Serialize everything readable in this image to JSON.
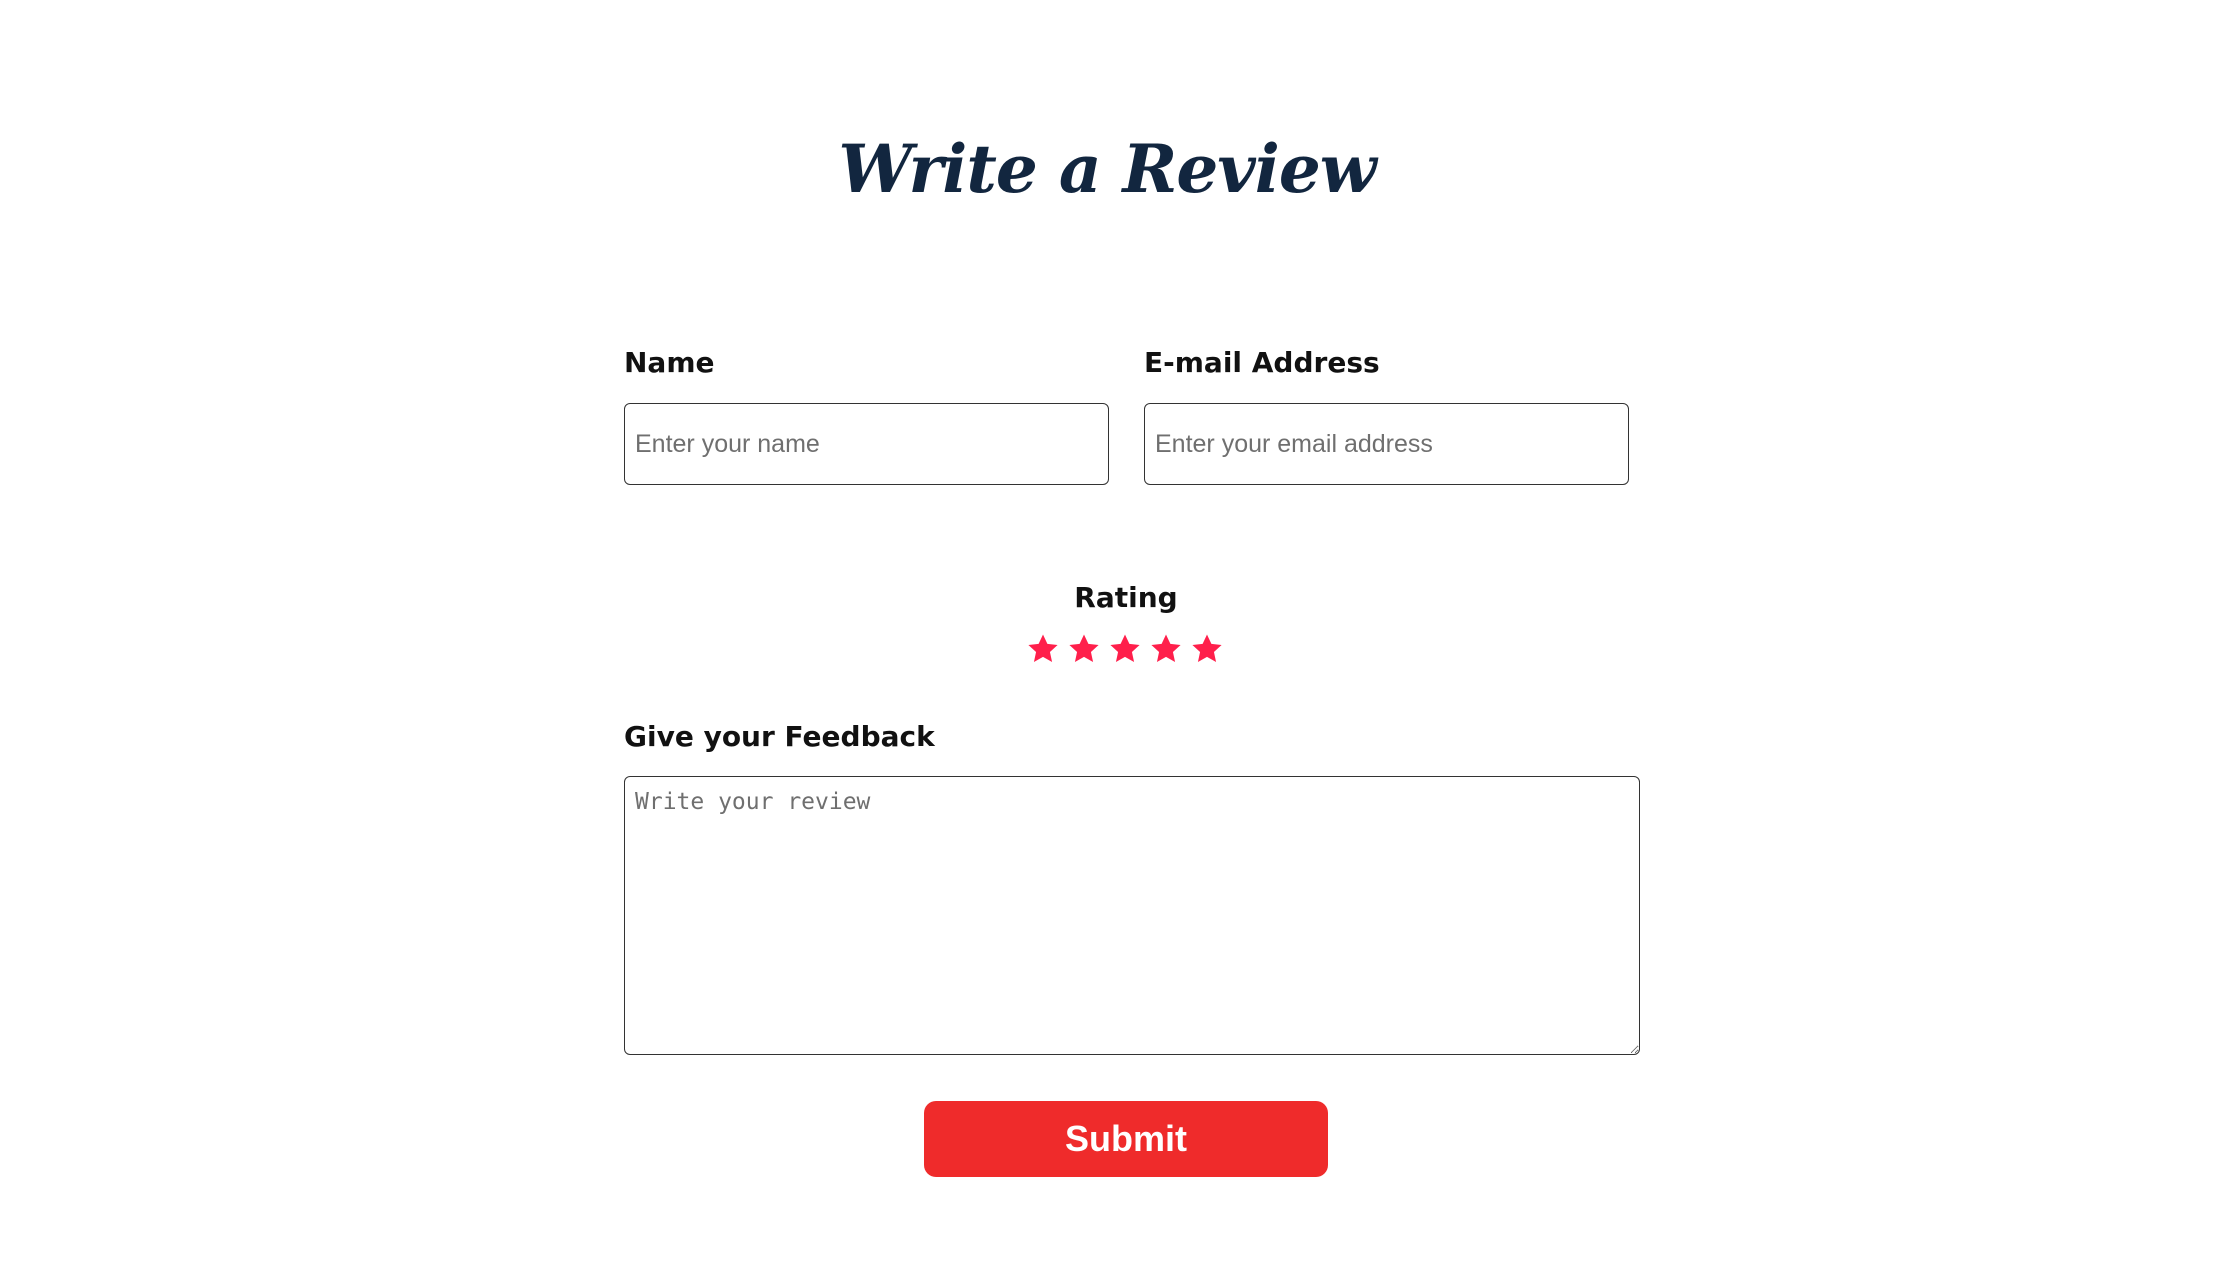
{
  "page": {
    "title": "Write a Review"
  },
  "form": {
    "name": {
      "label": "Name",
      "placeholder": "Enter your name",
      "value": ""
    },
    "email": {
      "label": "E-mail Address",
      "placeholder": "Enter your email address",
      "value": ""
    },
    "rating": {
      "label": "Rating",
      "value": 5,
      "max": 5,
      "star_color": "#ff1f4b",
      "icon": "star-icon"
    },
    "feedback": {
      "label": "Give your Feedback",
      "placeholder": "Write your review",
      "value": ""
    },
    "submit_label": "Submit"
  },
  "colors": {
    "title": "#12263f",
    "submit_bg": "#ef2b2b"
  }
}
